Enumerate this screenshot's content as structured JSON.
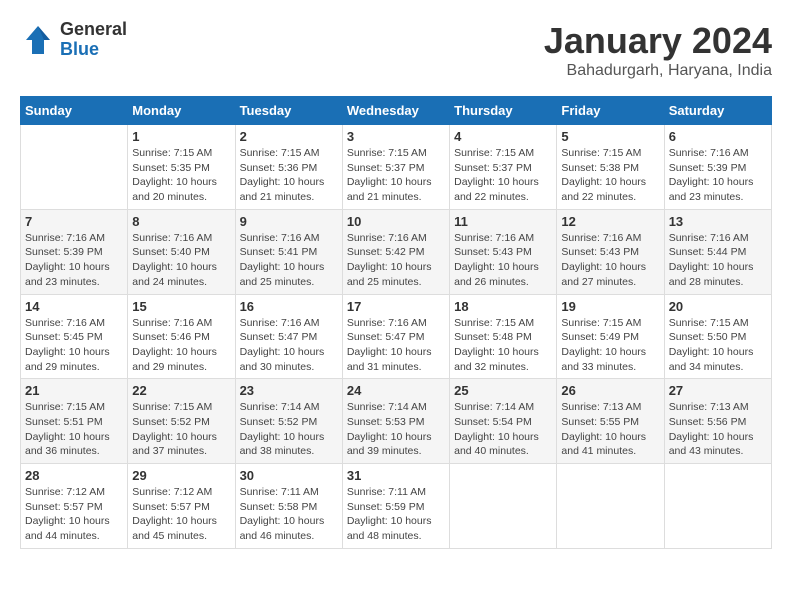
{
  "logo": {
    "general": "General",
    "blue": "Blue"
  },
  "title": {
    "month": "January 2024",
    "location": "Bahadurgarh, Haryana, India"
  },
  "days_of_week": [
    "Sunday",
    "Monday",
    "Tuesday",
    "Wednesday",
    "Thursday",
    "Friday",
    "Saturday"
  ],
  "weeks": [
    [
      {
        "day": "",
        "info": ""
      },
      {
        "day": "1",
        "info": "Sunrise: 7:15 AM\nSunset: 5:35 PM\nDaylight: 10 hours\nand 20 minutes."
      },
      {
        "day": "2",
        "info": "Sunrise: 7:15 AM\nSunset: 5:36 PM\nDaylight: 10 hours\nand 21 minutes."
      },
      {
        "day": "3",
        "info": "Sunrise: 7:15 AM\nSunset: 5:37 PM\nDaylight: 10 hours\nand 21 minutes."
      },
      {
        "day": "4",
        "info": "Sunrise: 7:15 AM\nSunset: 5:37 PM\nDaylight: 10 hours\nand 22 minutes."
      },
      {
        "day": "5",
        "info": "Sunrise: 7:15 AM\nSunset: 5:38 PM\nDaylight: 10 hours\nand 22 minutes."
      },
      {
        "day": "6",
        "info": "Sunrise: 7:16 AM\nSunset: 5:39 PM\nDaylight: 10 hours\nand 23 minutes."
      }
    ],
    [
      {
        "day": "7",
        "info": "Sunrise: 7:16 AM\nSunset: 5:39 PM\nDaylight: 10 hours\nand 23 minutes."
      },
      {
        "day": "8",
        "info": "Sunrise: 7:16 AM\nSunset: 5:40 PM\nDaylight: 10 hours\nand 24 minutes."
      },
      {
        "day": "9",
        "info": "Sunrise: 7:16 AM\nSunset: 5:41 PM\nDaylight: 10 hours\nand 25 minutes."
      },
      {
        "day": "10",
        "info": "Sunrise: 7:16 AM\nSunset: 5:42 PM\nDaylight: 10 hours\nand 25 minutes."
      },
      {
        "day": "11",
        "info": "Sunrise: 7:16 AM\nSunset: 5:43 PM\nDaylight: 10 hours\nand 26 minutes."
      },
      {
        "day": "12",
        "info": "Sunrise: 7:16 AM\nSunset: 5:43 PM\nDaylight: 10 hours\nand 27 minutes."
      },
      {
        "day": "13",
        "info": "Sunrise: 7:16 AM\nSunset: 5:44 PM\nDaylight: 10 hours\nand 28 minutes."
      }
    ],
    [
      {
        "day": "14",
        "info": "Sunrise: 7:16 AM\nSunset: 5:45 PM\nDaylight: 10 hours\nand 29 minutes."
      },
      {
        "day": "15",
        "info": "Sunrise: 7:16 AM\nSunset: 5:46 PM\nDaylight: 10 hours\nand 29 minutes."
      },
      {
        "day": "16",
        "info": "Sunrise: 7:16 AM\nSunset: 5:47 PM\nDaylight: 10 hours\nand 30 minutes."
      },
      {
        "day": "17",
        "info": "Sunrise: 7:16 AM\nSunset: 5:47 PM\nDaylight: 10 hours\nand 31 minutes."
      },
      {
        "day": "18",
        "info": "Sunrise: 7:15 AM\nSunset: 5:48 PM\nDaylight: 10 hours\nand 32 minutes."
      },
      {
        "day": "19",
        "info": "Sunrise: 7:15 AM\nSunset: 5:49 PM\nDaylight: 10 hours\nand 33 minutes."
      },
      {
        "day": "20",
        "info": "Sunrise: 7:15 AM\nSunset: 5:50 PM\nDaylight: 10 hours\nand 34 minutes."
      }
    ],
    [
      {
        "day": "21",
        "info": "Sunrise: 7:15 AM\nSunset: 5:51 PM\nDaylight: 10 hours\nand 36 minutes."
      },
      {
        "day": "22",
        "info": "Sunrise: 7:15 AM\nSunset: 5:52 PM\nDaylight: 10 hours\nand 37 minutes."
      },
      {
        "day": "23",
        "info": "Sunrise: 7:14 AM\nSunset: 5:52 PM\nDaylight: 10 hours\nand 38 minutes."
      },
      {
        "day": "24",
        "info": "Sunrise: 7:14 AM\nSunset: 5:53 PM\nDaylight: 10 hours\nand 39 minutes."
      },
      {
        "day": "25",
        "info": "Sunrise: 7:14 AM\nSunset: 5:54 PM\nDaylight: 10 hours\nand 40 minutes."
      },
      {
        "day": "26",
        "info": "Sunrise: 7:13 AM\nSunset: 5:55 PM\nDaylight: 10 hours\nand 41 minutes."
      },
      {
        "day": "27",
        "info": "Sunrise: 7:13 AM\nSunset: 5:56 PM\nDaylight: 10 hours\nand 43 minutes."
      }
    ],
    [
      {
        "day": "28",
        "info": "Sunrise: 7:12 AM\nSunset: 5:57 PM\nDaylight: 10 hours\nand 44 minutes."
      },
      {
        "day": "29",
        "info": "Sunrise: 7:12 AM\nSunset: 5:57 PM\nDaylight: 10 hours\nand 45 minutes."
      },
      {
        "day": "30",
        "info": "Sunrise: 7:11 AM\nSunset: 5:58 PM\nDaylight: 10 hours\nand 46 minutes."
      },
      {
        "day": "31",
        "info": "Sunrise: 7:11 AM\nSunset: 5:59 PM\nDaylight: 10 hours\nand 48 minutes."
      },
      {
        "day": "",
        "info": ""
      },
      {
        "day": "",
        "info": ""
      },
      {
        "day": "",
        "info": ""
      }
    ]
  ]
}
